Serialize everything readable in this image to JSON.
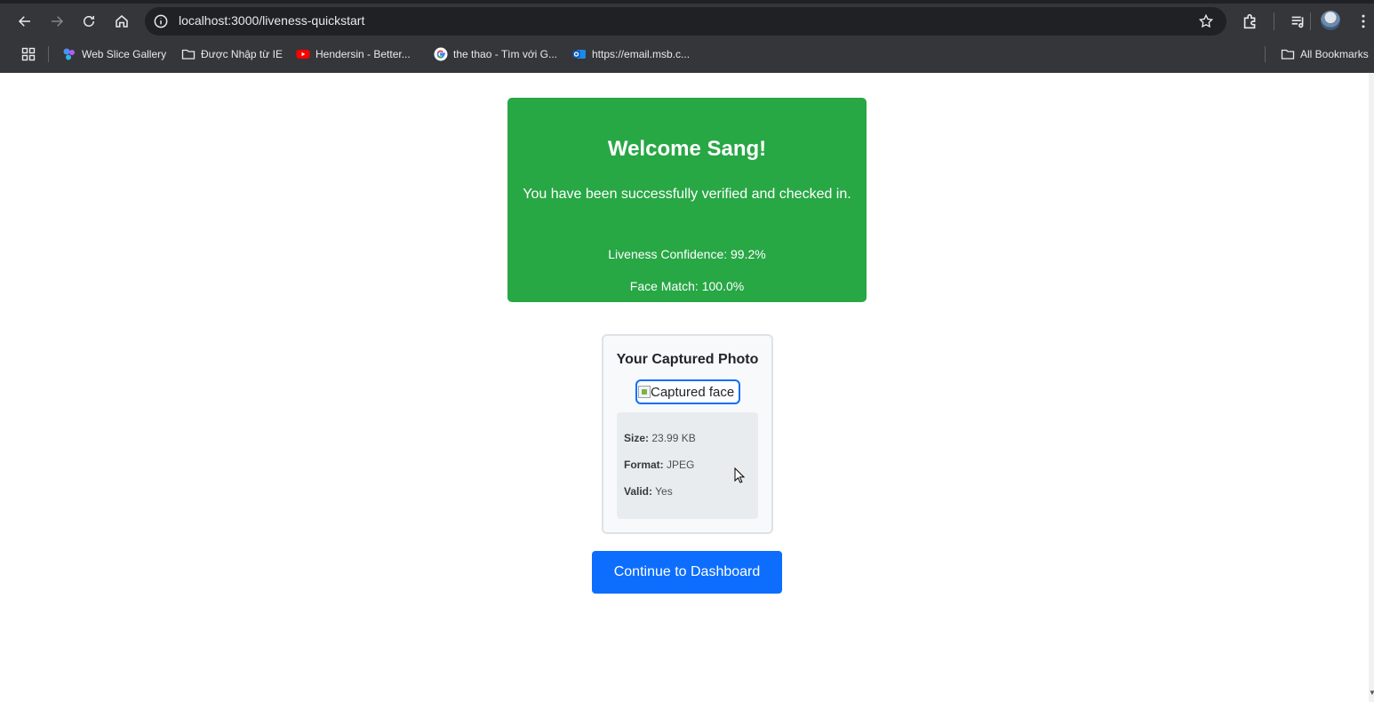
{
  "browser": {
    "url": "localhost:3000/liveness-quickstart",
    "bookmarks": [
      {
        "label": "Web Slice Gallery",
        "icon": "web-slice-icon"
      },
      {
        "label": "Được Nhập từ IE",
        "icon": "folder-icon"
      },
      {
        "label": "Hendersin - Better...",
        "icon": "youtube-icon"
      },
      {
        "label": "the thao - Tìm với G...",
        "icon": "google-icon"
      },
      {
        "label": "https://email.msb.c...",
        "icon": "outlook-icon"
      }
    ],
    "all_bookmarks": "All Bookmarks",
    "colors": {
      "chrome": "#35363a",
      "omnibox": "#202124"
    }
  },
  "success": {
    "title": "Welcome Sang!",
    "message": "You have been successfully verified and checked in.",
    "liveness": "Liveness Confidence: 99.2%",
    "face_match": "Face Match: 100.0%",
    "color": "#28a745"
  },
  "photo": {
    "title": "Your Captured Photo",
    "alt": "Captured face",
    "size_label": "Size:",
    "size_value": "23.99 KB",
    "format_label": "Format:",
    "format_value": "JPEG",
    "valid_label": "Valid:",
    "valid_value": "Yes"
  },
  "actions": {
    "continue_label": "Continue to Dashboard",
    "color": "#0d6efd"
  }
}
